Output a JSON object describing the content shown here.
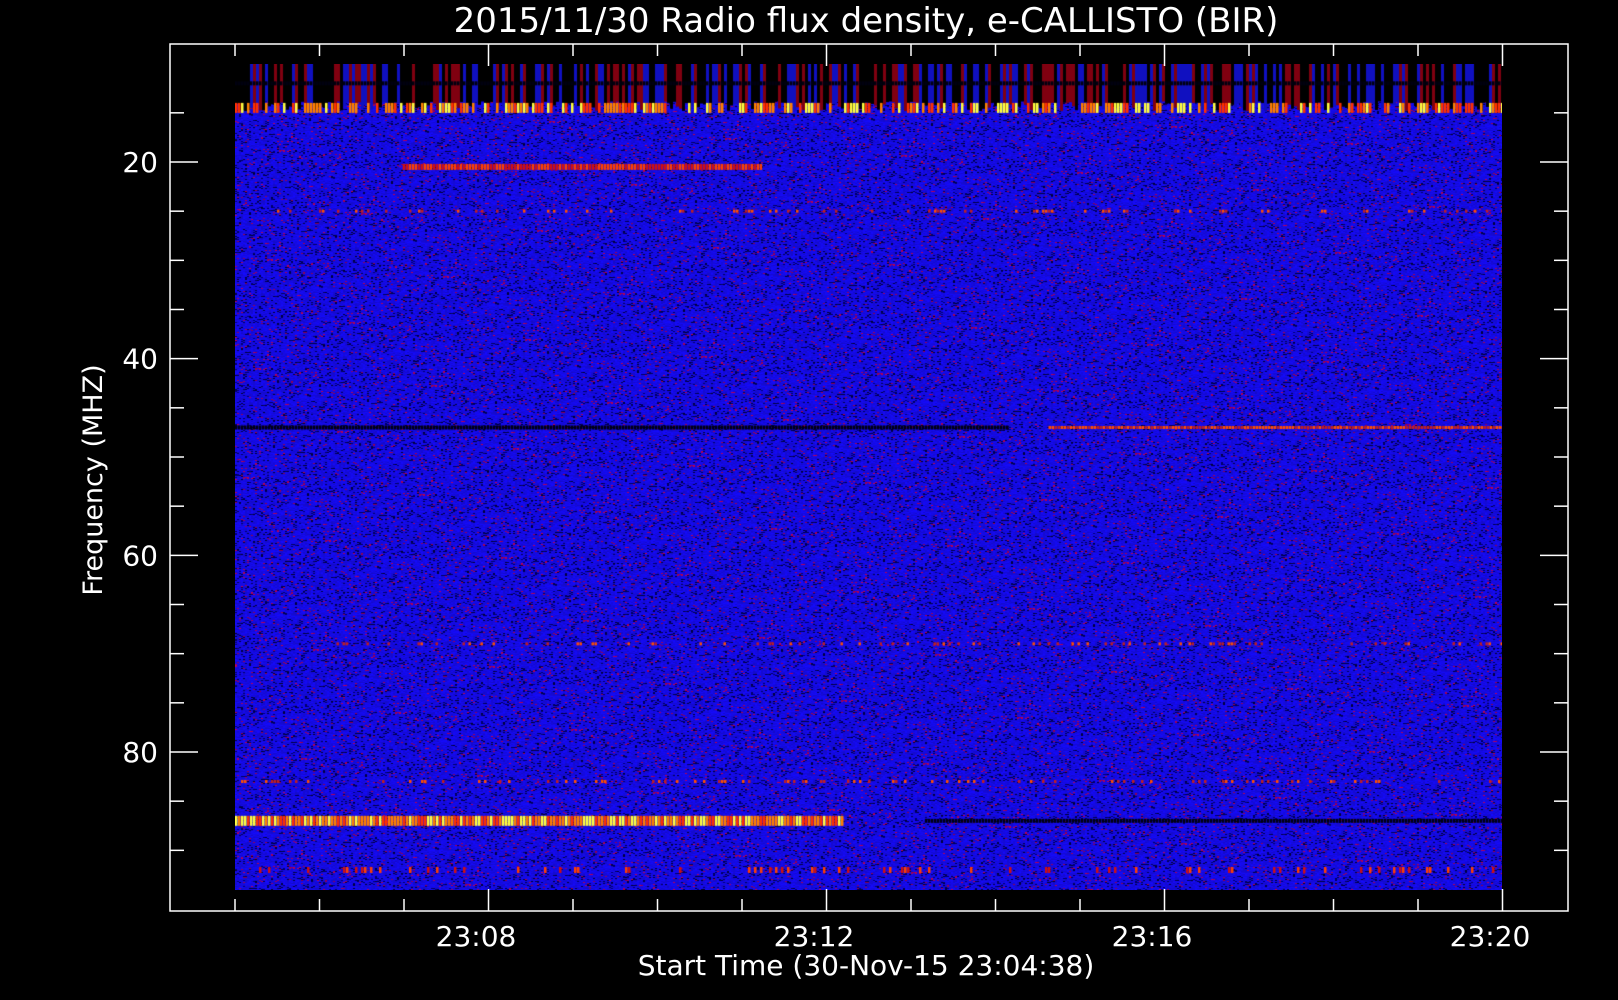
{
  "chart_data": {
    "type": "heatmap",
    "title": "2015/11/30  Radio flux density, e-CALLISTO (BIR)",
    "xlabel": "Start Time (30-Nov-15 23:04:38)",
    "ylabel": "Frequency (MHZ)",
    "x_range": [
      "23:04:38",
      "23:20:00"
    ],
    "y_range_mhz": [
      10,
      94
    ],
    "y_axis_inverted": true,
    "x_ticks": [
      "23:08",
      "23:12",
      "23:16",
      "23:20"
    ],
    "y_ticks": [
      20,
      40,
      60,
      80
    ],
    "colormap": [
      "#000000",
      "#0000ff",
      "#cc0000",
      "#ff6600",
      "#ffff00"
    ],
    "background_color": "#1010e0",
    "bright_bands": [
      {
        "freq_mhz": 14.5,
        "from": "23:04:38",
        "to": "23:20:00",
        "intensity": "high",
        "pattern": "intermittent"
      },
      {
        "freq_mhz": 20.5,
        "from": "23:06:40",
        "to": "23:11:00",
        "intensity": "medium"
      },
      {
        "freq_mhz": 25,
        "from": "23:04:38",
        "to": "23:20:00",
        "intensity": "low",
        "pattern": "dotted"
      },
      {
        "freq_mhz": 47,
        "from": "23:14:30",
        "to": "23:20:00",
        "intensity": "low"
      },
      {
        "freq_mhz": 69,
        "from": "23:05:30",
        "to": "23:20:00",
        "intensity": "low",
        "pattern": "dotted"
      },
      {
        "freq_mhz": 83,
        "from": "23:04:38",
        "to": "23:20:00",
        "intensity": "low",
        "pattern": "dotted"
      },
      {
        "freq_mhz": 87,
        "from": "23:04:38",
        "to": "23:12:00",
        "intensity": "high"
      },
      {
        "freq_mhz": 92,
        "from": "23:04:38",
        "to": "23:20:00",
        "intensity": "medium",
        "pattern": "dotted"
      }
    ],
    "dark_bands": [
      {
        "freq_mhz": 87,
        "from": "23:13:00",
        "to": "23:20:00"
      },
      {
        "freq_mhz": 47,
        "from": "23:04:38",
        "to": "23:14:00"
      },
      {
        "freq_mhz": 12,
        "from": "23:04:38",
        "to": "23:20:00"
      }
    ]
  }
}
